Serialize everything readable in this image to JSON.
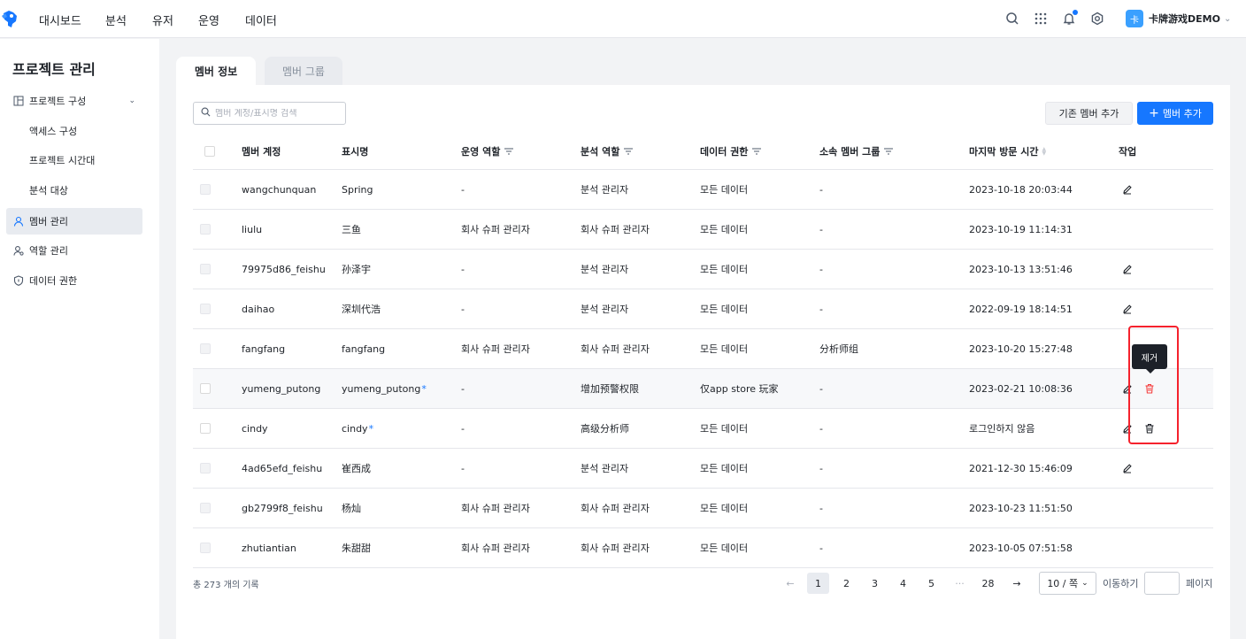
{
  "nav": {
    "items": [
      "대시보드",
      "분석",
      "유저",
      "운영",
      "데이터"
    ],
    "project_badge": "卡",
    "project_name": "卡牌游戏DEMO"
  },
  "sidebar": {
    "title": "프로젝트 관리",
    "items": [
      {
        "label": "프로젝트 구성",
        "icon": "layout-icon"
      },
      {
        "label": "액세스 구성"
      },
      {
        "label": "프로젝트 시간대"
      },
      {
        "label": "분석 대상"
      },
      {
        "label": "멤버 관리",
        "icon": "user-icon",
        "active": true
      },
      {
        "label": "역할 관리",
        "icon": "user-settings-icon"
      },
      {
        "label": "데이터 권한",
        "icon": "shield-icon"
      }
    ]
  },
  "tabs": [
    "멤버 정보",
    "멤버 그룹"
  ],
  "toolbar": {
    "search_placeholder": "멤버 계정/표시명 검색",
    "add_existing_label": "기존 멤버 추가",
    "add_member_label": "멤버 추가"
  },
  "table": {
    "headers": [
      "멤버 계정",
      "표시명",
      "운영 역할",
      "분석 역할",
      "데이터 권한",
      "소속 멤버 그룹",
      "마지막 방문 시간",
      "작업"
    ],
    "rows": [
      {
        "account": "wangchunquan",
        "display": "Spring",
        "star": "",
        "ops": "-",
        "analysis": "분석 관리자",
        "data": "모든 데이터",
        "group": "-",
        "last": "2023-10-18 20:03:44",
        "edit": true
      },
      {
        "account": "liulu",
        "display": "三鱼",
        "star": "",
        "ops": "회사 슈퍼 관리자",
        "analysis": "회사 슈퍼 관리자",
        "data": "모든 데이터",
        "group": "-",
        "last": "2023-10-19 11:14:31",
        "edit": false
      },
      {
        "account": "79975d86_feishu",
        "display": "孙泽宇",
        "star": "",
        "ops": "-",
        "analysis": "분석 관리자",
        "data": "모든 데이터",
        "group": "-",
        "last": "2023-10-13 13:51:46",
        "edit": true
      },
      {
        "account": "daihao",
        "display": "深圳代浩",
        "star": "",
        "ops": "-",
        "analysis": "분석 관리자",
        "data": "모든 데이터",
        "group": "-",
        "last": "2022-09-19 18:14:51",
        "edit": true
      },
      {
        "account": "fangfang",
        "display": "fangfang",
        "star": "",
        "ops": "회사 슈퍼 관리자",
        "analysis": "회사 슈퍼 관리자",
        "data": "모든 데이터",
        "group": "分析师组",
        "last": "2023-10-20 15:27:48",
        "edit": false
      },
      {
        "account": "yumeng_putong",
        "display": "yumeng_putong",
        "star": "*",
        "ops": "-",
        "analysis": "增加预警权限",
        "data": "仅app store 玩家",
        "group": "-",
        "last": "2023-02-21 10:08:36",
        "edit": true,
        "remove": true
      },
      {
        "account": "cindy",
        "display": "cindy",
        "star": "*",
        "ops": "-",
        "analysis": "高级分析师",
        "data": "모든 데이터",
        "group": "-",
        "last": "로그인하지 않음",
        "edit": true,
        "remove": true
      },
      {
        "account": "4ad65efd_feishu",
        "display": "崔西成",
        "star": "",
        "ops": "-",
        "analysis": "분석 관리자",
        "data": "모든 데이터",
        "group": "-",
        "last": "2021-12-30 15:46:09",
        "edit": true
      },
      {
        "account": "gb2799f8_feishu",
        "display": "杨灿",
        "star": "",
        "ops": "회사 슈퍼 관리자",
        "analysis": "회사 슈퍼 관리자",
        "data": "모든 데이터",
        "group": "-",
        "last": "2023-10-23 11:51:50",
        "edit": false
      },
      {
        "account": "zhutiantian",
        "display": "朱甜甜",
        "star": "",
        "ops": "회사 슈퍼 관리자",
        "analysis": "회사 슈퍼 관리자",
        "data": "모든 데이터",
        "group": "-",
        "last": "2023-10-05 07:51:58",
        "edit": false
      }
    ]
  },
  "tooltip": "제거",
  "footer": {
    "total": "총 273 개의 기록",
    "pages": [
      "1",
      "2",
      "3",
      "4",
      "5",
      "···",
      "28"
    ],
    "current_page": "1",
    "page_size": "10 / 쪽",
    "jump_label": "이동하기",
    "page_label": "페이지"
  },
  "colors": {
    "accent": "#1677ff",
    "danger": "#f53f3f",
    "highlight": "#f5222d"
  }
}
